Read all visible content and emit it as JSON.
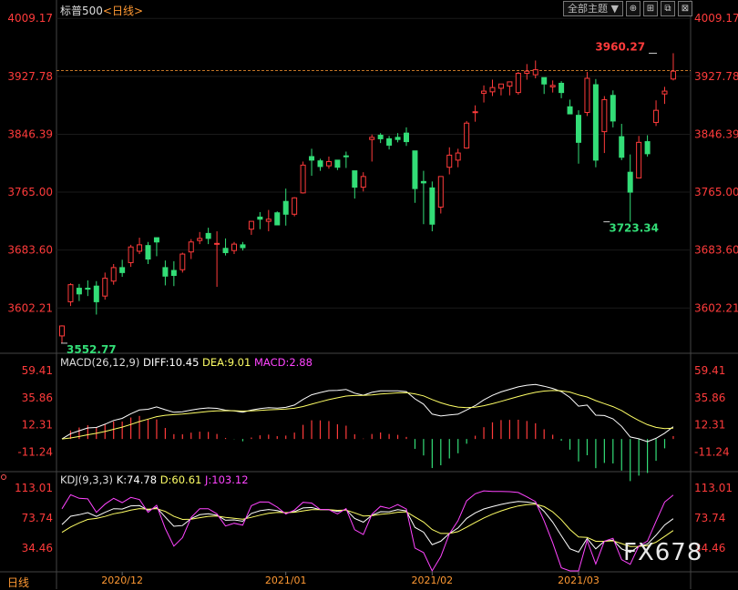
{
  "header": {
    "instrument": "标普500",
    "period": "<日线>",
    "theme_button": "全部主题",
    "theme_arrow": "▼",
    "tool_icons": [
      "crosshair-icon",
      "grid-icon",
      "split-icon",
      "close-icon"
    ]
  },
  "period_tab": "日线",
  "watermark": "FX678",
  "colors": {
    "up": "#ff3b3b",
    "down": "#33dd77",
    "diff": "#ffffff",
    "dea": "#ffff66",
    "macd": "#ff44ff",
    "k": "#ffffff",
    "d": "#ffff66",
    "j": "#ff44ff",
    "axis_label": "#ff3b3b",
    "annot_high": "#ff3b3b",
    "annot_low": "#33dd77"
  },
  "chart_data": [
    {
      "type": "candlestick",
      "yticks": [
        4009.17,
        3927.78,
        3846.39,
        3765.0,
        3683.6,
        3602.21
      ],
      "ytick_labels": [
        "4009.17",
        "3927.78",
        "3846.39",
        "3765.00",
        "3683.60",
        "3602.21"
      ],
      "ylim": [
        3545,
        4012
      ],
      "xtick_labels": [
        "2020/12",
        "2021/01",
        "2021/02",
        "2021/03"
      ],
      "xtick_index": [
        7,
        26,
        43,
        60
      ],
      "reference_line": 3936,
      "annotations": [
        {
          "label": "3960.27",
          "index": 69,
          "value": 3960.27,
          "kind": "high"
        },
        {
          "label": "3723.34",
          "index": 63,
          "value": 3723.34,
          "kind": "low"
        },
        {
          "label": "3552.77",
          "index": 0,
          "value": 3552.77,
          "kind": "low"
        }
      ],
      "ohlc": [
        [
          3563,
          3578,
          3552.77,
          3577
        ],
        [
          3611,
          3637,
          3605,
          3635
        ],
        [
          3630,
          3636,
          3612,
          3622
        ],
        [
          3630,
          3641,
          3619,
          3629
        ],
        [
          3633,
          3640,
          3593,
          3611
        ],
        [
          3619,
          3652,
          3614,
          3644
        ],
        [
          3640,
          3664,
          3635,
          3659
        ],
        [
          3659,
          3670,
          3646,
          3652
        ],
        [
          3666,
          3691,
          3660,
          3688
        ],
        [
          3682,
          3701,
          3678,
          3691
        ],
        [
          3690,
          3695,
          3664,
          3671
        ],
        [
          3701,
          3701,
          3675,
          3695
        ],
        [
          3659,
          3669,
          3634,
          3647
        ],
        [
          3655,
          3668,
          3633,
          3648
        ],
        [
          3656,
          3680,
          3652,
          3678
        ],
        [
          3681,
          3699,
          3671,
          3695
        ],
        [
          3697,
          3709,
          3692,
          3700
        ],
        [
          3707,
          3715,
          3692,
          3700
        ],
        [
          3692,
          3710,
          3632,
          3693
        ],
        [
          3686,
          3700,
          3676,
          3680
        ],
        [
          3683,
          3695,
          3678,
          3692
        ],
        [
          3691,
          3695,
          3683,
          3687
        ],
        [
          3713,
          3724,
          3705,
          3724
        ],
        [
          3730,
          3737,
          3713,
          3727
        ],
        [
          3724,
          3740,
          3710,
          3727
        ],
        [
          3736,
          3738,
          3719,
          3719
        ],
        [
          3752,
          3770,
          3718,
          3734
        ],
        [
          3734,
          3758,
          3731,
          3757
        ],
        [
          3764,
          3808,
          3763,
          3803
        ],
        [
          3815,
          3826,
          3788,
          3810
        ],
        [
          3809,
          3812,
          3795,
          3801
        ],
        [
          3802,
          3815,
          3798,
          3808
        ],
        [
          3810,
          3810,
          3796,
          3800
        ],
        [
          3816,
          3822,
          3799,
          3815
        ],
        [
          3795,
          3795,
          3756,
          3772
        ],
        [
          3772,
          3793,
          3766,
          3787
        ],
        [
          3839,
          3846,
          3808,
          3842
        ],
        [
          3845,
          3848,
          3834,
          3840
        ],
        [
          3840,
          3844,
          3825,
          3831
        ],
        [
          3842,
          3848,
          3835,
          3839
        ],
        [
          3848,
          3856,
          3830,
          3836
        ],
        [
          3823,
          3823,
          3750,
          3770
        ],
        [
          3780,
          3795,
          3720,
          3778
        ],
        [
          3771,
          3780,
          3710,
          3720
        ],
        [
          3744,
          3787,
          3735,
          3787
        ],
        [
          3800,
          3828,
          3790,
          3817
        ],
        [
          3810,
          3826,
          3800,
          3820
        ],
        [
          3827,
          3865,
          3826,
          3862
        ],
        [
          3877,
          3887,
          3864,
          3878
        ],
        [
          3904,
          3915,
          3891,
          3907
        ],
        [
          3906,
          3923,
          3900,
          3912
        ],
        [
          3911,
          3915,
          3901,
          3917
        ],
        [
          3914,
          3920,
          3901,
          3920
        ],
        [
          3905,
          3934,
          3902,
          3932
        ],
        [
          3932,
          3945,
          3923,
          3935
        ],
        [
          3930,
          3950,
          3925,
          3937
        ],
        [
          3926,
          3926,
          3903,
          3917
        ],
        [
          3913,
          3922,
          3905,
          3915
        ],
        [
          3918,
          3921,
          3897,
          3905
        ],
        [
          3885,
          3895,
          3875,
          3875
        ],
        [
          3873,
          3880,
          3805,
          3835
        ],
        [
          3877,
          3934,
          3872,
          3925
        ],
        [
          3916,
          3924,
          3800,
          3810
        ],
        [
          3850,
          3900,
          3820,
          3895
        ],
        [
          3901,
          3908,
          3856,
          3865
        ],
        [
          3843,
          3861,
          3810,
          3814
        ],
        [
          3793,
          3818,
          3723.34,
          3765
        ],
        [
          3785,
          3844,
          3785,
          3835
        ],
        [
          3836,
          3845,
          3815,
          3819
        ],
        [
          3863,
          3894,
          3858,
          3880
        ],
        [
          3903,
          3913,
          3889,
          3907
        ],
        [
          3924,
          3960.27,
          3922,
          3935
        ]
      ]
    },
    {
      "type": "line",
      "name": "MACD(26,12,9)",
      "ylim": [
        -26,
        65
      ],
      "yticks": [
        59.41,
        35.86,
        12.31,
        -11.24
      ],
      "ytick_labels": [
        "59.41",
        "35.86",
        "12.31",
        "-11.24"
      ],
      "legend": {
        "title": "MACD(26,12,9)",
        "diff": "DIFF:10.45",
        "dea": "DEA:9.01",
        "macd": "MACD:2.88"
      }
    },
    {
      "type": "line",
      "name": "KDJ(9,3,3)",
      "ylim": [
        5,
        120
      ],
      "yticks": [
        113.01,
        73.74,
        34.46
      ],
      "ytick_labels": [
        "113.01",
        "73.74",
        "34.46"
      ],
      "legend": {
        "title": "KDJ(9,3,3)",
        "k": "K:74.78",
        "d": "D:60.61",
        "j": "J:103.12"
      }
    }
  ]
}
